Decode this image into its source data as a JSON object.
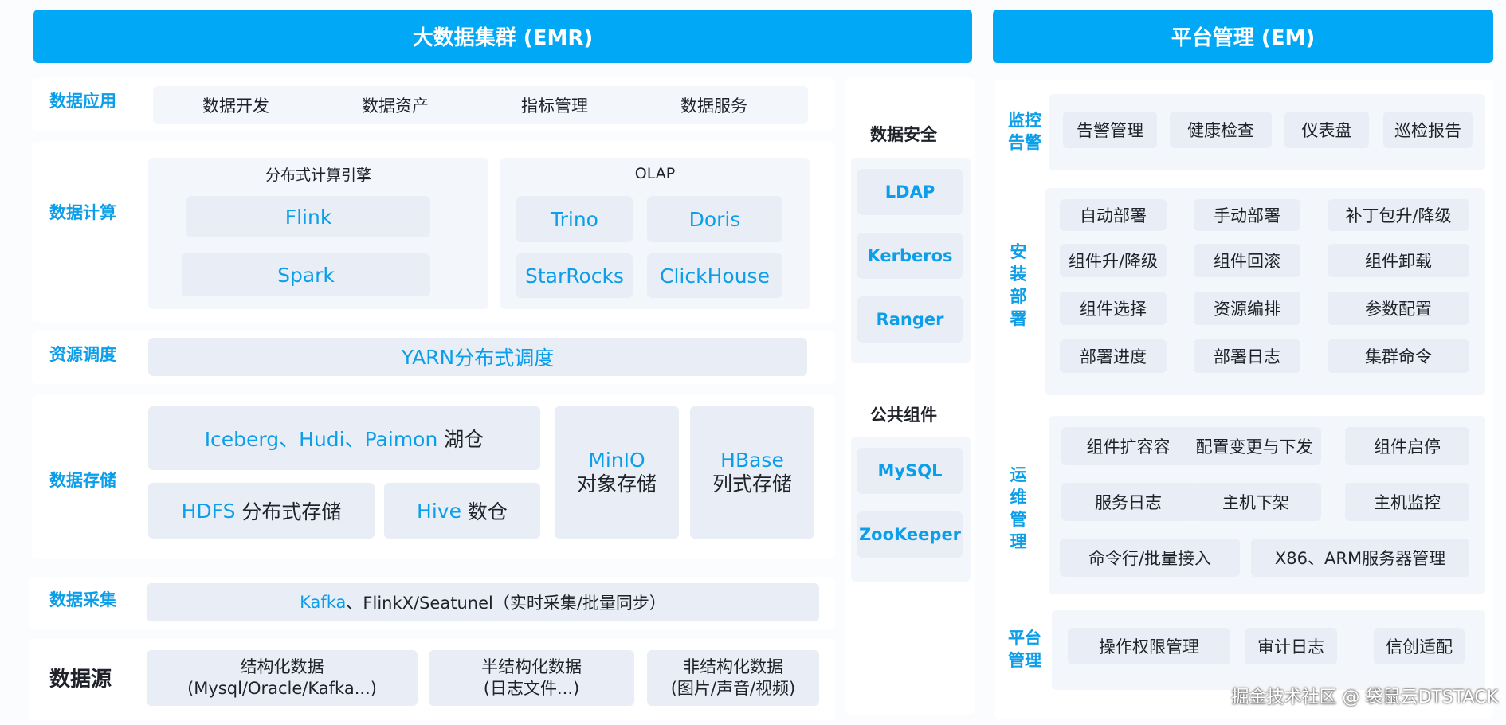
{
  "emr": {
    "title": "大数据集群 (EMR)",
    "app": {
      "label": "数据应用",
      "items": [
        "数据开发",
        "数据资产",
        "指标管理",
        "数据服务"
      ]
    },
    "compute": {
      "label": "数据计算",
      "engine_title": "分布式计算引擎",
      "engines": [
        "Flink",
        "Spark"
      ],
      "olap_title": "OLAP",
      "olap": [
        "Trino",
        "Doris",
        "StarRocks",
        "ClickHouse"
      ]
    },
    "schedule": {
      "label": "资源调度",
      "yarn_main": "YARN",
      "yarn_sub": "分布式调度"
    },
    "storage": {
      "label": "数据存储",
      "lake_main": "Iceberg、Hudi、Paimon",
      "lake_sub": "湖仓",
      "hdfs_main": "HDFS",
      "hdfs_sub": "分布式存储",
      "hive_main": "Hive",
      "hive_sub": "数仓",
      "minio_main": "MinIO",
      "minio_sub": "对象存储",
      "hbase_main": "HBase",
      "hbase_sub": "列式存储"
    },
    "collect": {
      "label": "数据采集",
      "kafka": "Kafka",
      "rest": "、FlinkX/Seatunel（实时采集/批量同步）"
    },
    "source": {
      "label": "数据源",
      "items": [
        {
          "line1": "结构化数据",
          "line2": "(Mysql/Oracle/Kafka...)"
        },
        {
          "line1": "半结构化数据",
          "line2": "(日志文件...)"
        },
        {
          "line1": "非结构化数据",
          "line2": "(图片/声音/视频)"
        }
      ]
    }
  },
  "side": {
    "security": {
      "title": "数据安全",
      "items": [
        "LDAP",
        "Kerberos",
        "Ranger"
      ]
    },
    "common": {
      "title": "公共组件",
      "items": [
        "MySQL",
        "ZooKeeper"
      ]
    }
  },
  "em": {
    "title": "平台管理 (EM)",
    "monitor": {
      "label": [
        "监控",
        "告警"
      ],
      "items": [
        "告警管理",
        "健康检查",
        "仪表盘",
        "巡检报告"
      ]
    },
    "deploy": {
      "label": [
        "安",
        "装",
        "部",
        "署"
      ],
      "items": [
        "自动部署",
        "手动部署",
        "补丁包升/降级",
        "组件升/降级",
        "组件回滚",
        "组件卸载",
        "组件选择",
        "资源编排",
        "参数配置",
        "部署进度",
        "部署日志",
        "集群命令"
      ]
    },
    "ops": {
      "label": [
        "运",
        "维",
        "管",
        "理"
      ],
      "items": [
        "组件扩容容",
        "配置变更与下发",
        "组件启停",
        "服务日志",
        "主机下架",
        "主机监控",
        "命令行/批量接入",
        "X86、ARM服务器管理"
      ]
    },
    "platform": {
      "label": [
        "平台",
        "管理"
      ],
      "items": [
        "操作权限管理",
        "审计日志",
        "信创适配"
      ]
    }
  },
  "watermark": "掘金技术社区 @ 袋鼠云DTSTACK"
}
